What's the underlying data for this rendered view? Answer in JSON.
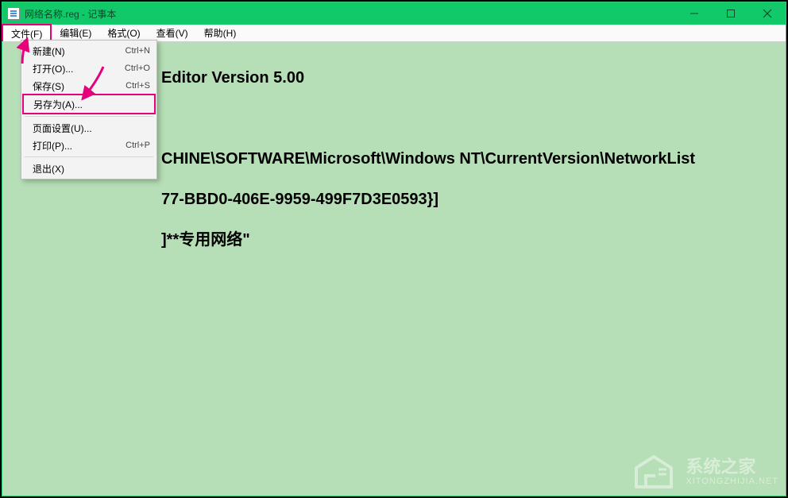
{
  "titlebar": {
    "title": "网络名称.reg - 记事本"
  },
  "menubar": {
    "items": [
      {
        "label": "文件(F)"
      },
      {
        "label": "编辑(E)"
      },
      {
        "label": "格式(O)"
      },
      {
        "label": "查看(V)"
      },
      {
        "label": "帮助(H)"
      }
    ]
  },
  "dropdown": {
    "items": [
      {
        "label": "新建(N)",
        "shortcut": "Ctrl+N"
      },
      {
        "label": "打开(O)...",
        "shortcut": "Ctrl+O"
      },
      {
        "label": "保存(S)",
        "shortcut": "Ctrl+S"
      },
      {
        "label": "另存为(A)...",
        "shortcut": "",
        "highlight": true
      },
      {
        "sep": true
      },
      {
        "label": "页面设置(U)...",
        "shortcut": ""
      },
      {
        "label": "打印(P)...",
        "shortcut": "Ctrl+P"
      },
      {
        "sep": true
      },
      {
        "label": "退出(X)",
        "shortcut": ""
      }
    ]
  },
  "content": {
    "line1_suffix": "Editor Version 5.00",
    "line2_suffix": "CHINE\\SOFTWARE\\Microsoft\\Windows NT\\CurrentVersion\\NetworkList",
    "line3_suffix": "77-BBD0-406E-9959-499F7D3E0593}]",
    "line4_suffix": "]**专用网络\""
  },
  "watermark": {
    "main": "系统之家",
    "sub": "XITONGZHIJIA.NET"
  }
}
